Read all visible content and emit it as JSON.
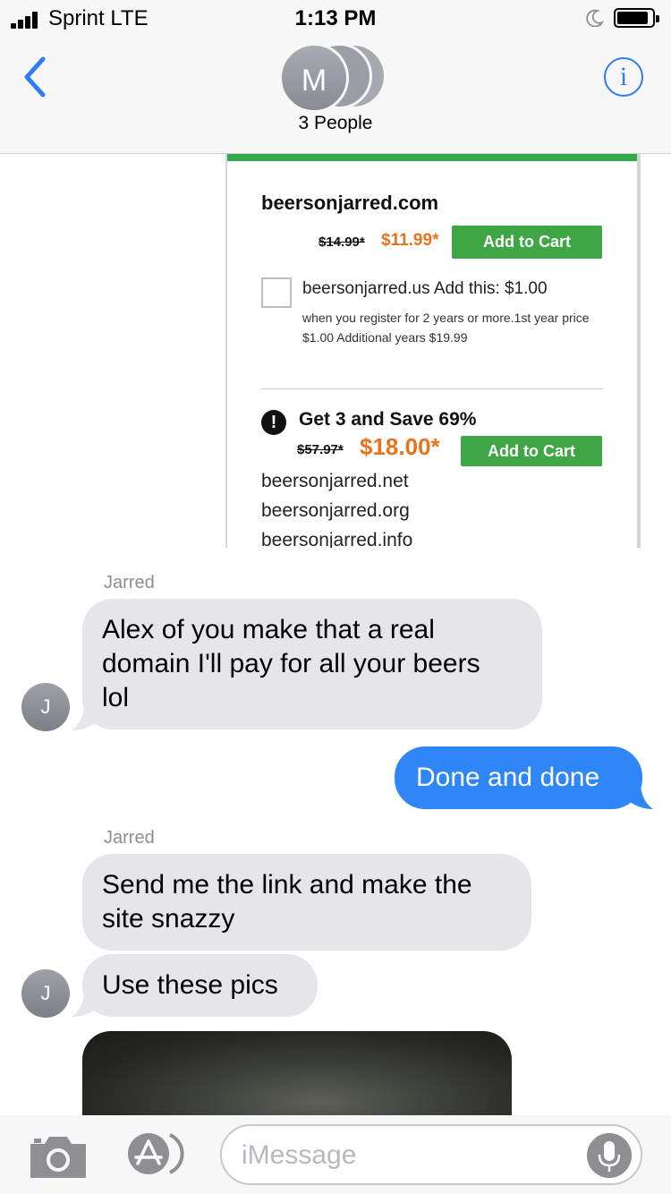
{
  "status_bar": {
    "carrier": "Sprint  LTE",
    "time": "1:13 PM"
  },
  "header": {
    "avatar_initial": "M",
    "group_name": "3 People",
    "info_icon_glyph": "i"
  },
  "shared_image": {
    "domain": "beersonjarred.com",
    "old_price": "$14.99*",
    "new_price": "$11.99*",
    "add_to_cart": "Add to Cart",
    "addon_line": "beersonjarred.us Add this: $1.00",
    "addon_note": "when you register for 2 years or more.1st year price $1.00 Additional years $19.99",
    "alert_glyph": "!",
    "bundle_title": "Get 3 and Save 69%",
    "bundle_old_price": "$57.97*",
    "bundle_new_price": "$18.00*",
    "bundle_add_to_cart": "Add to Cart",
    "bundle_domains": [
      "beersonjarred.net",
      "beersonjarred.org",
      "beersonjarred.info"
    ]
  },
  "messages": [
    {
      "sender": "Jarred",
      "direction": "incoming",
      "lines": [
        "Alex of you make that a real",
        "domain I'll pay for all your beers",
        "lol"
      ],
      "avatar": "J"
    },
    {
      "direction": "outgoing",
      "lines": [
        "Done and done"
      ]
    },
    {
      "sender": "Jarred",
      "direction": "incoming",
      "lines": [
        "Send me the link and make the",
        "site snazzy"
      ]
    },
    {
      "direction": "incoming",
      "lines": [
        "Use these pics"
      ],
      "avatar": "J"
    }
  ],
  "input_bar": {
    "placeholder": "iMessage"
  },
  "colors": {
    "ios_blue": "#2f7cf6",
    "outgoing_bubble": "#2f86f7",
    "incoming_bubble": "#e5e5ea",
    "price_orange": "#e8731c",
    "cart_green": "#3fa646"
  },
  "icons": [
    "signal-bars-icon",
    "moon-icon",
    "battery-icon",
    "back-chevron-icon",
    "info-icon",
    "camera-icon",
    "appstore-icon",
    "microphone-icon"
  ]
}
